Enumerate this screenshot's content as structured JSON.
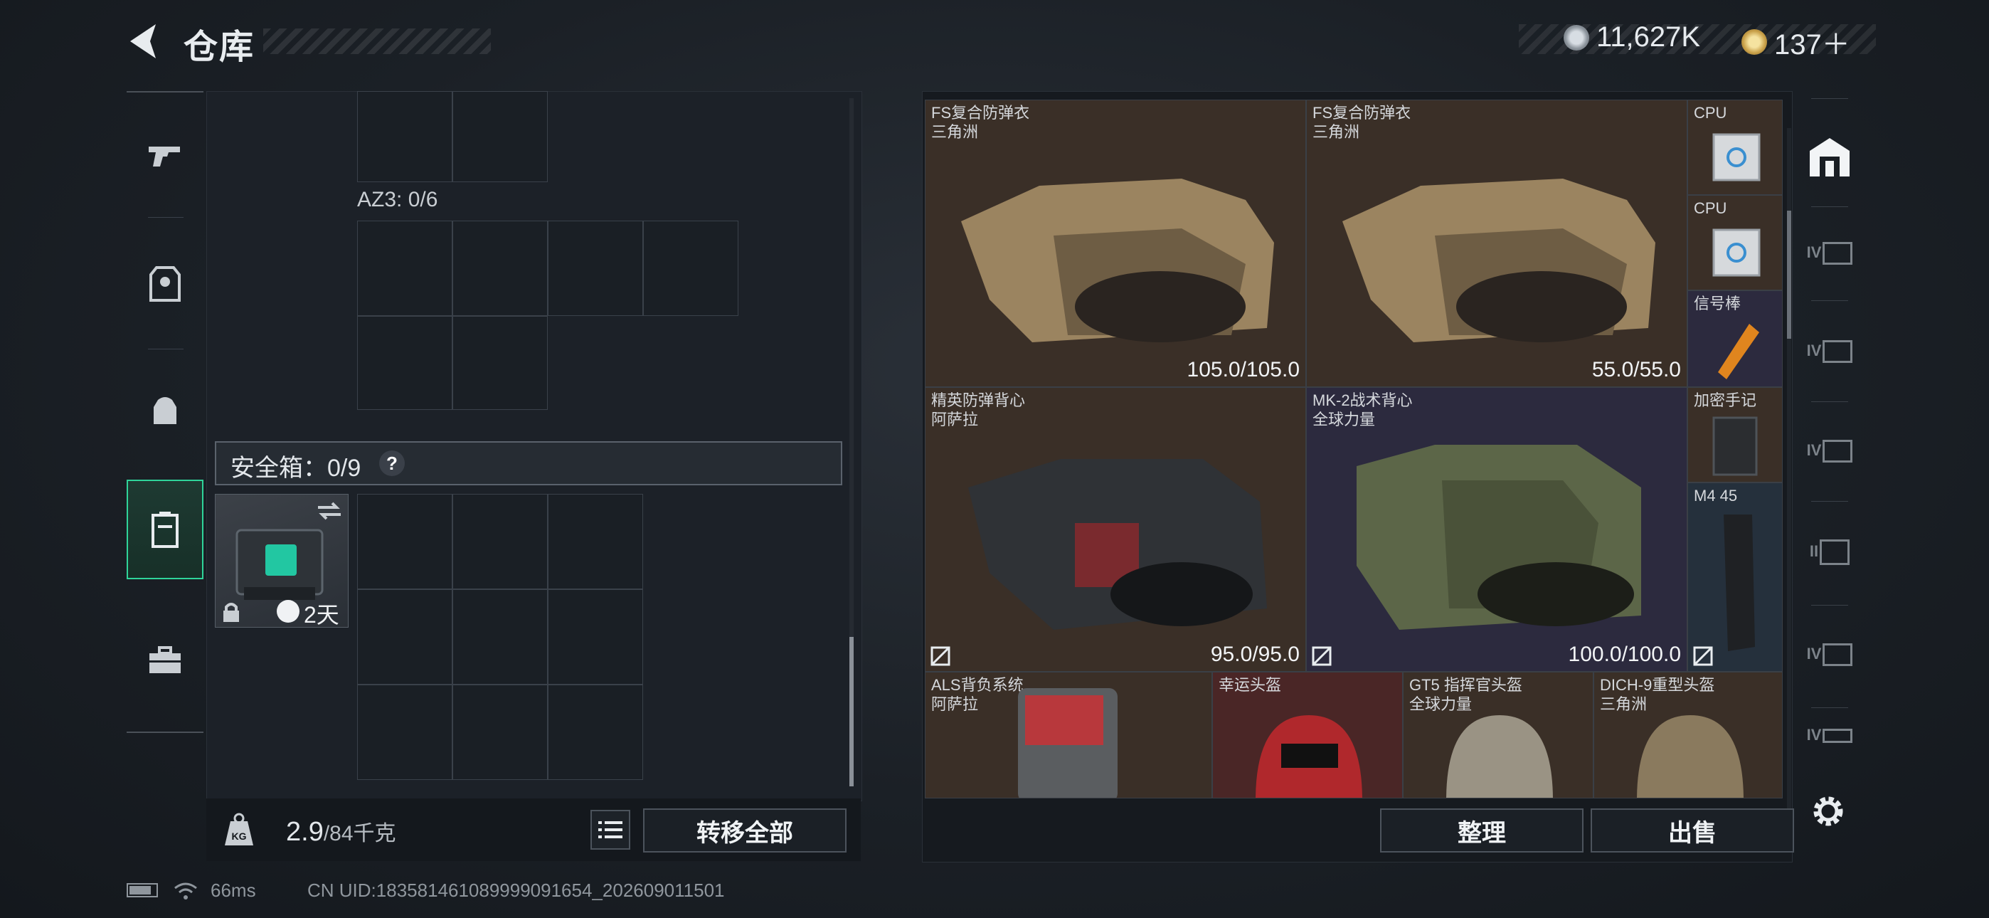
{
  "header": {
    "title": "仓库"
  },
  "currency": [
    {
      "icon": "silver-coin-icon",
      "value": "11,627K"
    },
    {
      "icon": "gold-coin-icon",
      "value": "137＋"
    }
  ],
  "left_nav": [
    {
      "icon": "gun-icon",
      "active": false
    },
    {
      "icon": "body-armor-icon",
      "active": false
    },
    {
      "icon": "backpack-icon",
      "active": false
    },
    {
      "icon": "safe-case-icon",
      "active": true
    },
    {
      "icon": "toolbox-icon",
      "active": false
    }
  ],
  "container": {
    "az3_label": "AZ3: 0/6"
  },
  "safebox": {
    "label": "安全箱：0/9",
    "help": "?",
    "item_timer": "2天"
  },
  "footer_left": {
    "weight_current": "2.9",
    "weight_cap": "/84千克",
    "transfer_all": "转移全部"
  },
  "items": [
    {
      "name": "FS复合防弹衣",
      "origin": "三角洲",
      "durability": "105.0/105.0"
    },
    {
      "name": "FS复合防弹衣",
      "origin": "三角洲",
      "durability": "55.0/55.0"
    },
    {
      "name": "CPU"
    },
    {
      "name": "CPU"
    },
    {
      "name": "信号棒"
    },
    {
      "name": "精英防弹背心",
      "origin": "阿萨拉",
      "durability": "95.0/95.0"
    },
    {
      "name": "MK-2战术背心",
      "origin": "全球力量",
      "durability": "100.0/100.0"
    },
    {
      "name": "加密手记"
    },
    {
      "name": "M4 45"
    },
    {
      "name": "ALS背负系统",
      "origin": "阿萨拉"
    },
    {
      "name": "幸运头盔"
    },
    {
      "name": "GT5 指挥官头盔",
      "origin": "全球力量"
    },
    {
      "name": "DICH-9重型头盔",
      "origin": "三角洲"
    }
  ],
  "actions": {
    "sort": "整理",
    "sell": "出售"
  },
  "right_nav": [
    {
      "icon": "warehouse-icon"
    },
    {
      "icon": "tier-iv-case-icon",
      "tier": "IV"
    },
    {
      "icon": "tier-iv-case-icon",
      "tier": "IV"
    },
    {
      "icon": "tier-iv-case-icon",
      "tier": "IV"
    },
    {
      "icon": "tier-ii-case-icon",
      "tier": "II"
    },
    {
      "icon": "tier-iv-case-icon",
      "tier": "IV"
    },
    {
      "icon": "tier-iv-case-icon",
      "tier": "IV"
    }
  ],
  "status": {
    "ping": "66ms",
    "uid": "CN UID:18358146108999909165​4_202609011501"
  },
  "colors": {
    "accent": "#2fd49a",
    "panel": "#1c2128",
    "brown_slot": "#3a2f27",
    "purple_slot": "#2c2a3e",
    "red_slot": "#4a2626"
  }
}
